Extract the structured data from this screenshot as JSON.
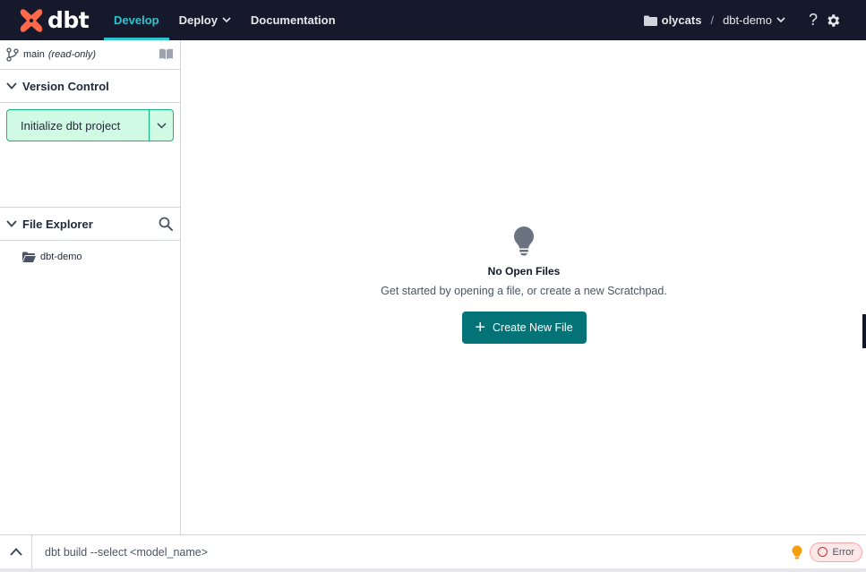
{
  "brand": {
    "name": "dbt"
  },
  "nav": {
    "develop": "Develop",
    "deploy": "Deploy",
    "documentation": "Documentation"
  },
  "account": {
    "name": "olycats",
    "separator": "/",
    "project": "dbt-demo"
  },
  "help": {
    "label": "?"
  },
  "sidebar": {
    "branch": {
      "name": "main",
      "status": "(read-only)"
    },
    "version_control": {
      "title": "Version Control",
      "button_label": "Initialize dbt project"
    },
    "file_explorer": {
      "title": "File Explorer",
      "items": [
        {
          "label": "dbt-demo"
        }
      ]
    }
  },
  "main": {
    "empty_title": "No Open Files",
    "empty_description": "Get started by opening a file, or create a new Scratchpad.",
    "create_button": "Create New File"
  },
  "command_bar": {
    "placeholder": "dbt build --select <model_name>",
    "status_label": "Error"
  },
  "colors": {
    "navbar": "#16192b",
    "accent": "#2ec4cf",
    "primary_button": "#047377",
    "success_bg": "#d1fae5",
    "success_border": "#10b981",
    "error": "#dc2626",
    "brand_orange": "#ff694a"
  },
  "icons": [
    "dbt-logo-icon",
    "chevron-down-icon",
    "folder-icon",
    "help-icon",
    "gear-icon",
    "git-branch-icon",
    "book-icon",
    "search-icon",
    "folder-open-icon",
    "lightbulb-icon",
    "plus-icon",
    "chevron-up-icon",
    "error-circle-icon"
  ]
}
